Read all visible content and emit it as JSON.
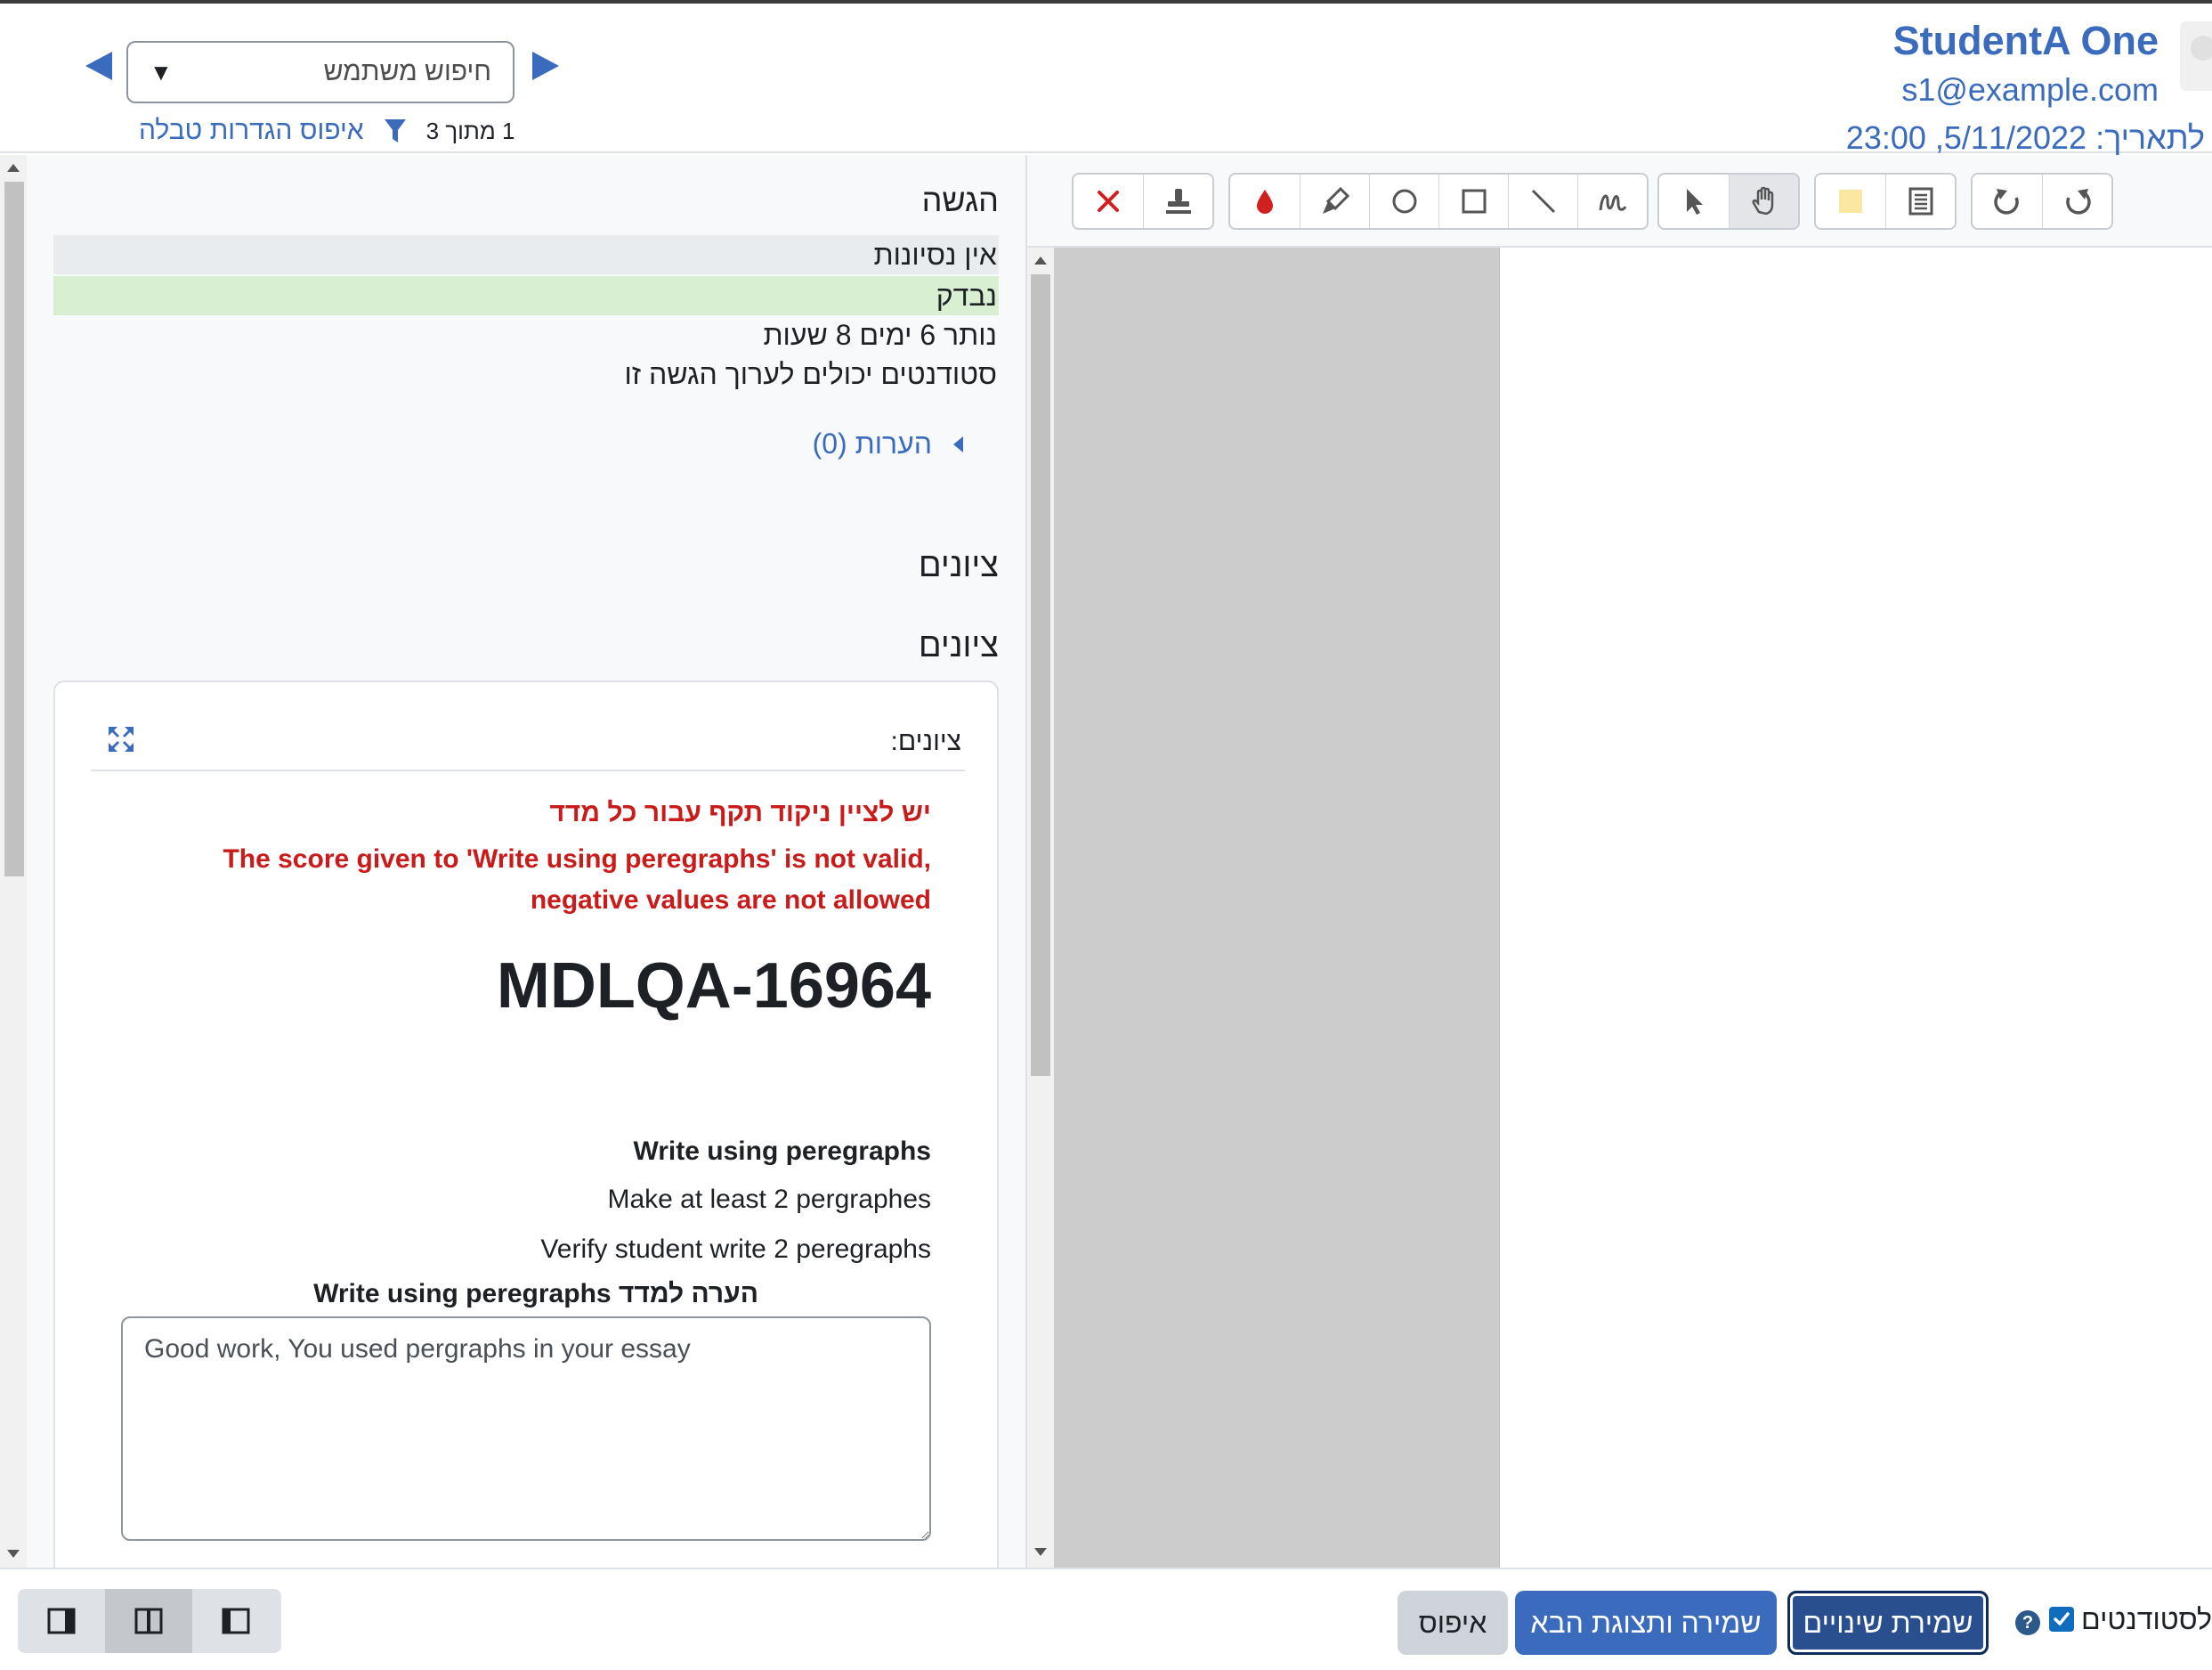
{
  "header": {
    "student_name": "StudentA One",
    "student_email": "s1@example.com",
    "due_date": "לתאריך: 5/11/2022, 23:00",
    "user_search_placeholder": "חיפוש משתמש",
    "filter_count": "1 מתוך 3",
    "reset_table_label": "איפוס הגדרות טבלה"
  },
  "submission": {
    "heading": "הגשה",
    "attempts": "אין נסיונות",
    "status": "נבדק",
    "time_remaining": "נותר 6 ימים 8 שעות",
    "edit_status": "סטודנטים יכולים לערוך הגשה זו",
    "comments_label": "הערות (0)"
  },
  "grades": {
    "heading_1": "ציונים",
    "heading_2": "ציונים",
    "card_label": "ציונים:",
    "error_he": "יש לציין ניקוד תקף עבור כל מדד",
    "error_en": "The score given to 'Write using peregraphs' is not valid, negative values are not allowed",
    "rubric_name": "MDLQA-16964",
    "criterion_title": "Write using peregraphs",
    "criterion_description": "Make at least 2 pergraphes",
    "criterion_level": "Verify student write 2 peregraphs",
    "remark_label": "הערה למדד Write using peregraphs",
    "remark_value": "Good work, You used pergraphs in your essay"
  },
  "toolbar": {
    "icons": [
      "redo-icon",
      "undo-icon",
      "comment-search-icon",
      "comment-icon",
      "pan-icon",
      "select-icon",
      "pen-icon",
      "line-icon",
      "rectangle-icon",
      "oval-icon",
      "highlight-icon",
      "color-icon",
      "stamp-icon",
      "delete-icon"
    ]
  },
  "footer": {
    "reset_label": "איפוס",
    "save_next_label": "שמירה ותצוגת הבא",
    "save_label": "שמירת שינויים",
    "notify_label": "לסטודנטים",
    "notify_checked": true
  },
  "colors": {
    "link": "#3a6bbd",
    "error": "#ca1b1b",
    "status_bg": "#d9efd2",
    "primary": "#3a6bbd",
    "primary_dark": "#2a4f8f"
  }
}
